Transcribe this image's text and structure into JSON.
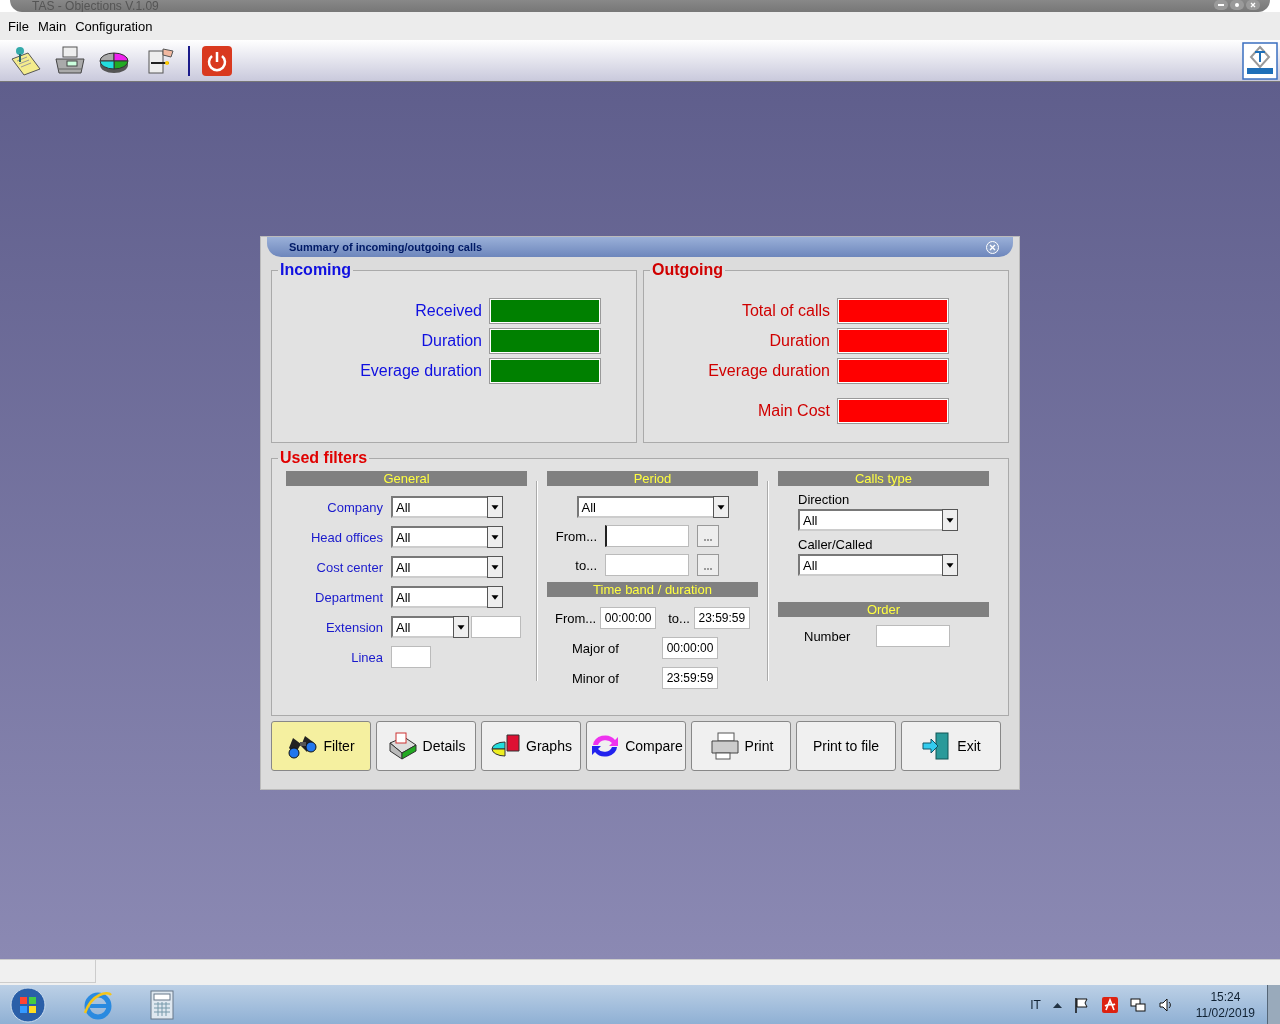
{
  "window": {
    "title": "TAS - Objections V.1.09"
  },
  "menu": [
    "File",
    "Main",
    "Configuration"
  ],
  "dialog": {
    "title": "Summary of incoming/outgoing calls",
    "sections": [
      {
        "title": "Incoming",
        "color": "#008000",
        "metrics": [
          {
            "label": "Received"
          },
          {
            "label": "Duration"
          },
          {
            "label": "Everage duration"
          }
        ]
      },
      {
        "title": "Outgoing",
        "color": "#ff0000",
        "metrics": [
          {
            "label": "Total of calls"
          },
          {
            "label": "Duration"
          },
          {
            "label": "Everage duration"
          },
          {
            "label": "Main Cost"
          }
        ]
      }
    ],
    "filters": {
      "title": "Used filters",
      "general": {
        "title": "General",
        "rows": [
          {
            "label": "Company",
            "kind": "combo",
            "value": "All"
          },
          {
            "label": "Head offices",
            "kind": "combo",
            "value": "All"
          },
          {
            "label": "Cost center",
            "kind": "combo",
            "value": "All"
          },
          {
            "label": "Department",
            "kind": "combo",
            "value": "All"
          },
          {
            "label": "Extension",
            "kind": "combotext",
            "value": "All"
          },
          {
            "label": "Linea",
            "kind": "text"
          }
        ]
      },
      "period": {
        "title": "Period",
        "value": "All",
        "from_label": "From...",
        "to_label": "to..."
      },
      "time_band": {
        "title": "Time band / duration",
        "from_label": "From...",
        "from_value": "00:00:00",
        "to_label": "to...",
        "to_value": "23:59:59",
        "major_label": "Major of",
        "major_value": "00:00:00",
        "minor_label": "Minor of",
        "minor_value": "23:59:59"
      },
      "calls_type": {
        "title": "Calls type",
        "direction_label": "Direction",
        "direction_value": "All",
        "caller_label": "Caller/Called",
        "caller_value": "All"
      },
      "order": {
        "title": "Order",
        "number_label": "Number"
      }
    },
    "buttons": [
      {
        "label": "Filter",
        "kind": "filter",
        "selected": true
      },
      {
        "label": "Details",
        "kind": "details",
        "selected": false
      },
      {
        "label": "Graphs",
        "kind": "graphs",
        "selected": false
      },
      {
        "label": "Compare",
        "kind": "compare",
        "selected": false
      },
      {
        "label": "Print",
        "kind": "print",
        "selected": false
      },
      {
        "label": "Print to file",
        "kind": "none",
        "selected": false
      },
      {
        "label": "Exit",
        "kind": "exit",
        "selected": false
      }
    ]
  },
  "taskbar": {
    "language": "IT",
    "time": "15:24",
    "date": "11/02/2019"
  }
}
